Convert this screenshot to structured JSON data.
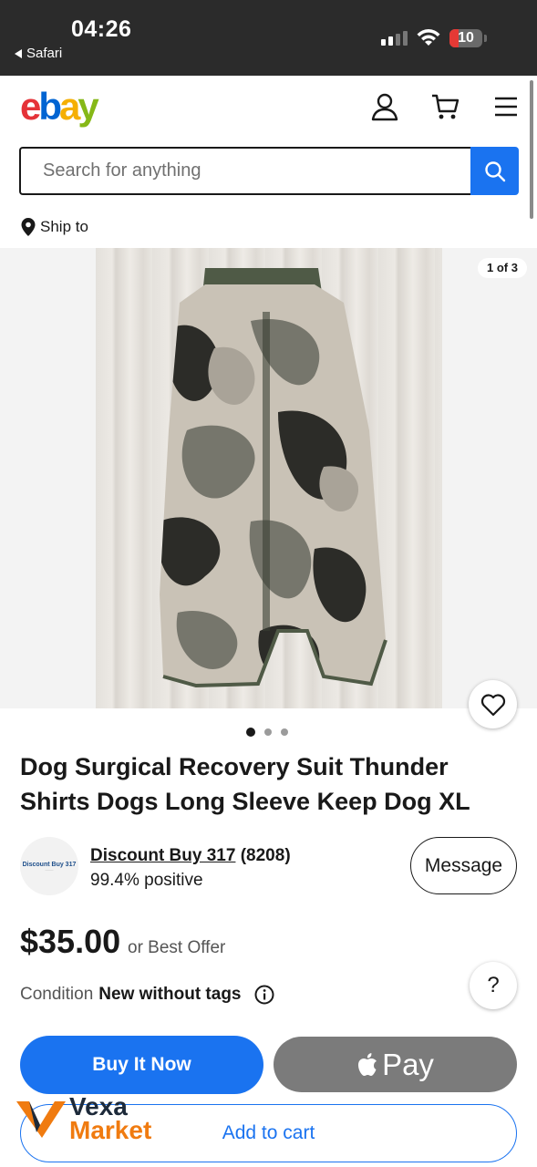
{
  "status_bar": {
    "time": "04:26",
    "back_app": "Safari",
    "battery_level": "10"
  },
  "header": {
    "logo": "ebay"
  },
  "search": {
    "placeholder": "Search for anything"
  },
  "ship_to": "Ship to",
  "gallery": {
    "counter": "1 of 3",
    "dot_count": 3,
    "active_dot": 0
  },
  "product": {
    "title": "Dog Surgical Recovery Suit Thunder Shirts Dogs Long Sleeve Keep Dog XL",
    "price": "$35.00",
    "best_offer": "or Best Offer",
    "condition_label": "Condition",
    "condition_value": "New without tags"
  },
  "seller": {
    "name": "Discount Buy 317",
    "feedback_count": "(8208)",
    "positive": "99.4% positive",
    "avatar_text": "Discount Buy 317"
  },
  "actions": {
    "message": "Message",
    "buy_now": "Buy It Now",
    "apple_pay": "Pay",
    "add_to_cart": "Add to cart",
    "help": "?"
  },
  "watermark": {
    "line1": "Vexa",
    "line2": "Market"
  },
  "colors": {
    "accent_blue": "#1a73f0",
    "ebay_red": "#e53238",
    "ebay_blue": "#0064d2",
    "ebay_yellow": "#f5af02",
    "ebay_green": "#86b817"
  }
}
